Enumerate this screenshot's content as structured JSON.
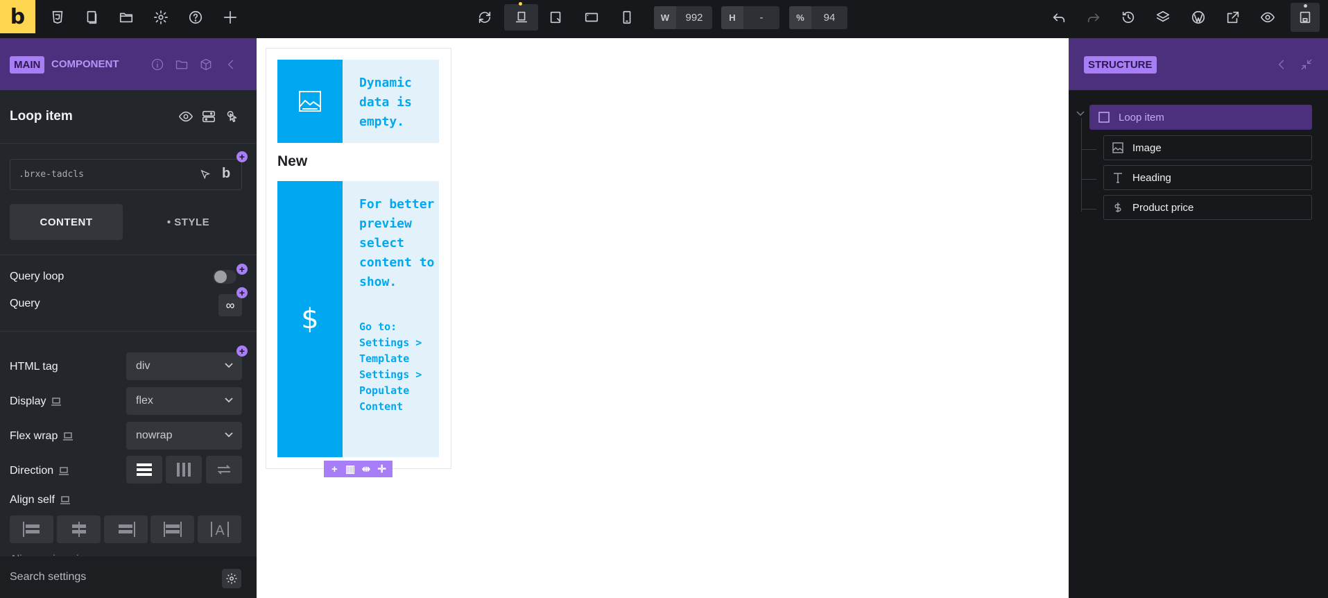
{
  "topbar": {
    "logo": "b",
    "width_label": "W",
    "width_value": "992",
    "height_label": "H",
    "height_value": "-",
    "zoom_label": "%",
    "zoom_value": "94"
  },
  "left_panel": {
    "tag_main": "MAIN",
    "tag_component": "COMPONENT",
    "element_title": "Loop item",
    "css_class": ".brxe-tadcls",
    "class_badge": "b",
    "tab_content": "CONTENT",
    "tab_style": "• STYLE",
    "query_loop_label": "Query loop",
    "query_label": "Query",
    "query_button": "∞",
    "html_tag_label": "HTML tag",
    "html_tag_value": "div",
    "display_label": "Display",
    "display_value": "flex",
    "flex_wrap_label": "Flex wrap",
    "flex_wrap_value": "nowrap",
    "direction_label": "Direction",
    "align_self_label": "Align self",
    "align_main_axis_label": "Align main axis",
    "search_placeholder": "Search settings"
  },
  "canvas": {
    "dynamic_empty_text": "Dynamic data is empty.",
    "heading_text": "New",
    "preview_text": "For better preview select content to show.",
    "goto_text": "Go to: Settings > Template Settings > Populate Content",
    "price_symbol": "$",
    "toolbar_symbols": [
      "+",
      "▥",
      "⇹",
      "✛"
    ]
  },
  "right_panel": {
    "tag_structure": "STRUCTURE",
    "tree": [
      {
        "label": "Loop item",
        "icon": "square-icon",
        "selected": true
      },
      {
        "label": "Image",
        "icon": "image-icon",
        "selected": false
      },
      {
        "label": "Heading",
        "icon": "heading-icon",
        "selected": false
      },
      {
        "label": "Product price",
        "icon": "dollar-icon",
        "selected": false
      }
    ]
  },
  "colors": {
    "accent_purple": "#a77ef6",
    "header_purple": "#4c2f7d",
    "brand_yellow": "#ffd64f",
    "card_blue": "#00a9ef",
    "card_bg": "#e3f1fb"
  }
}
